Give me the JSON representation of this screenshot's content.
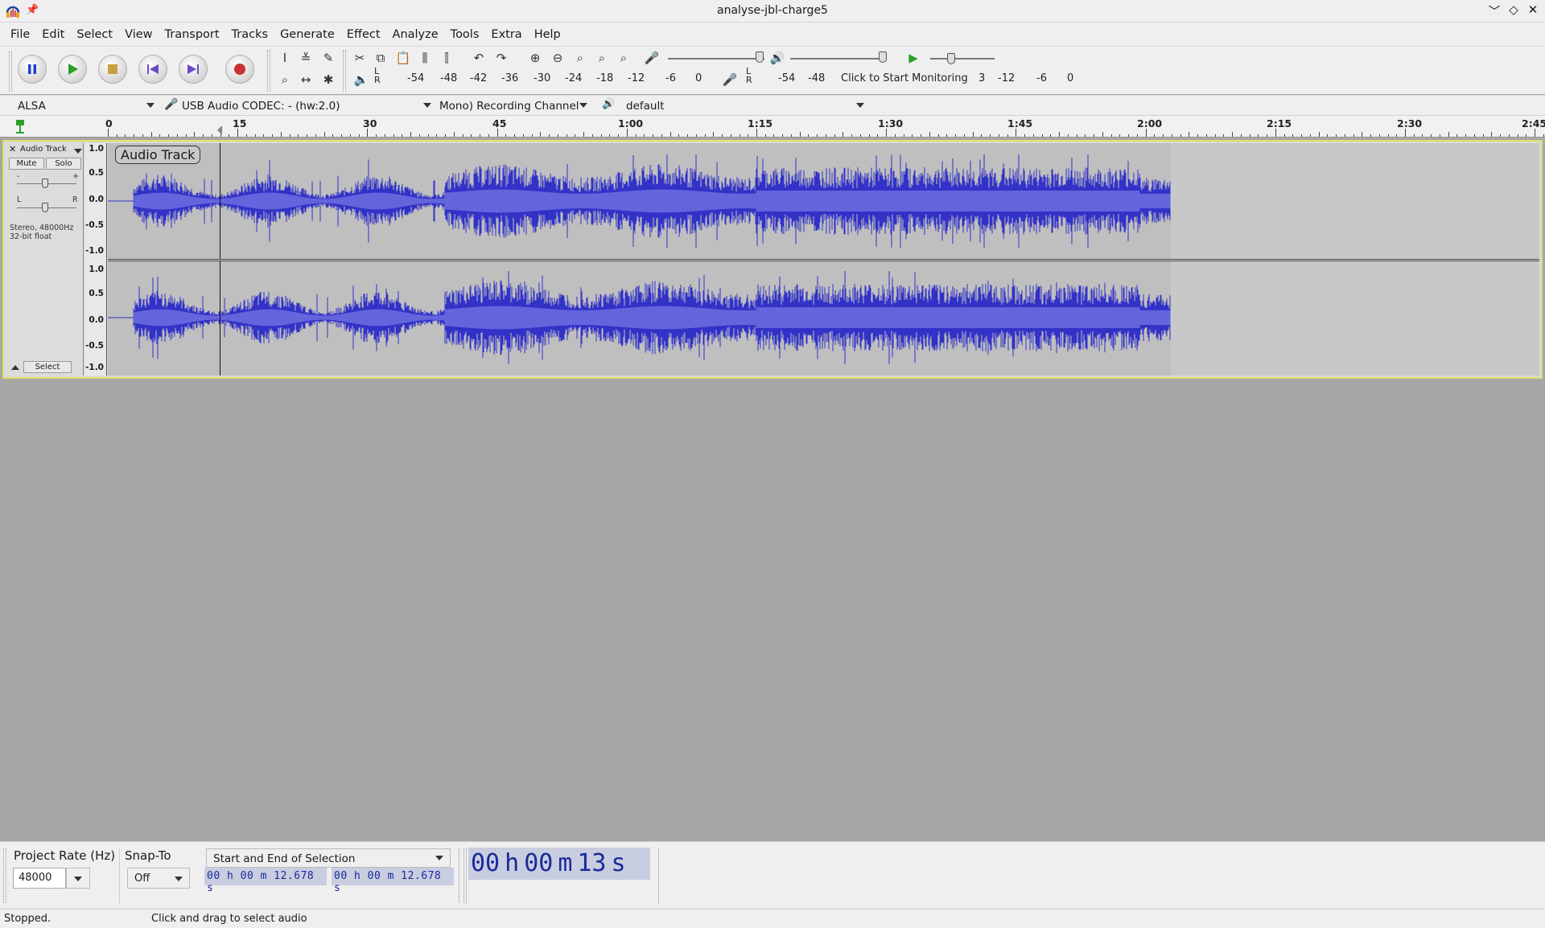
{
  "window": {
    "title": "analyse-jbl-charge5",
    "controls": [
      "﹀",
      "◇",
      "✕"
    ]
  },
  "menu": [
    "File",
    "Edit",
    "Select",
    "View",
    "Transport",
    "Tracks",
    "Generate",
    "Effect",
    "Analyze",
    "Tools",
    "Extra",
    "Help"
  ],
  "meters": {
    "record_scale": [
      "-54",
      "-48",
      "-42",
      "-36",
      "-30",
      "-24",
      "-18",
      "-12",
      "-6",
      "0"
    ],
    "playback_scale": [
      "-54",
      "-48"
    ],
    "monitor_text": "Click to Start Monitoring",
    "playback_tail": [
      "3",
      "-12",
      "-6",
      "0"
    ],
    "lr_top": "L",
    "lr_bottom": "R"
  },
  "devices": {
    "host": "ALSA",
    "recording_device": "USB Audio CODEC: - (hw:2.0)",
    "channels": "Mono) Recording Channel",
    "playback_device": "default"
  },
  "ruler": {
    "labels": [
      "0",
      "15",
      "30",
      "45",
      "1:00",
      "1:15",
      "1:30",
      "1:45",
      "2:00",
      "2:15",
      "2:30",
      "2:45"
    ]
  },
  "track": {
    "name": "Audio Track",
    "mute_label": "Mute",
    "solo_label": "Solo",
    "gain_minus": "-",
    "gain_plus": "+",
    "pan_left": "L",
    "pan_right": "R",
    "info_line1": "Stereo, 48000Hz",
    "info_line2": "32-bit float",
    "select_label": "Select",
    "clip_label": "Audio Track",
    "scale": [
      "1.0",
      "0.5",
      "0.0",
      "-0.5",
      "-1.0"
    ]
  },
  "selection_toolbar": {
    "project_rate_label": "Project Rate (Hz)",
    "project_rate_value": "48000",
    "snap_label": "Snap-To",
    "snap_value": "Off",
    "selection_mode": "Start and End of Selection",
    "start_time": "00 h 00 m 12.678 s",
    "end_time": "00 h 00 m 12.678 s",
    "audio_position": {
      "h": "00",
      "m": "00",
      "s": "13",
      "h_unit": "h",
      "m_unit": "m",
      "s_unit": "s"
    }
  },
  "status": {
    "state": "Stopped.",
    "hint": "Click and drag to select audio"
  },
  "colors": {
    "waveform": "#3232c8",
    "waveform_rms": "#6464dc",
    "selected_track_border": "#dfdf66",
    "record_button": "#c83232",
    "play_button": "#2aa02a"
  }
}
